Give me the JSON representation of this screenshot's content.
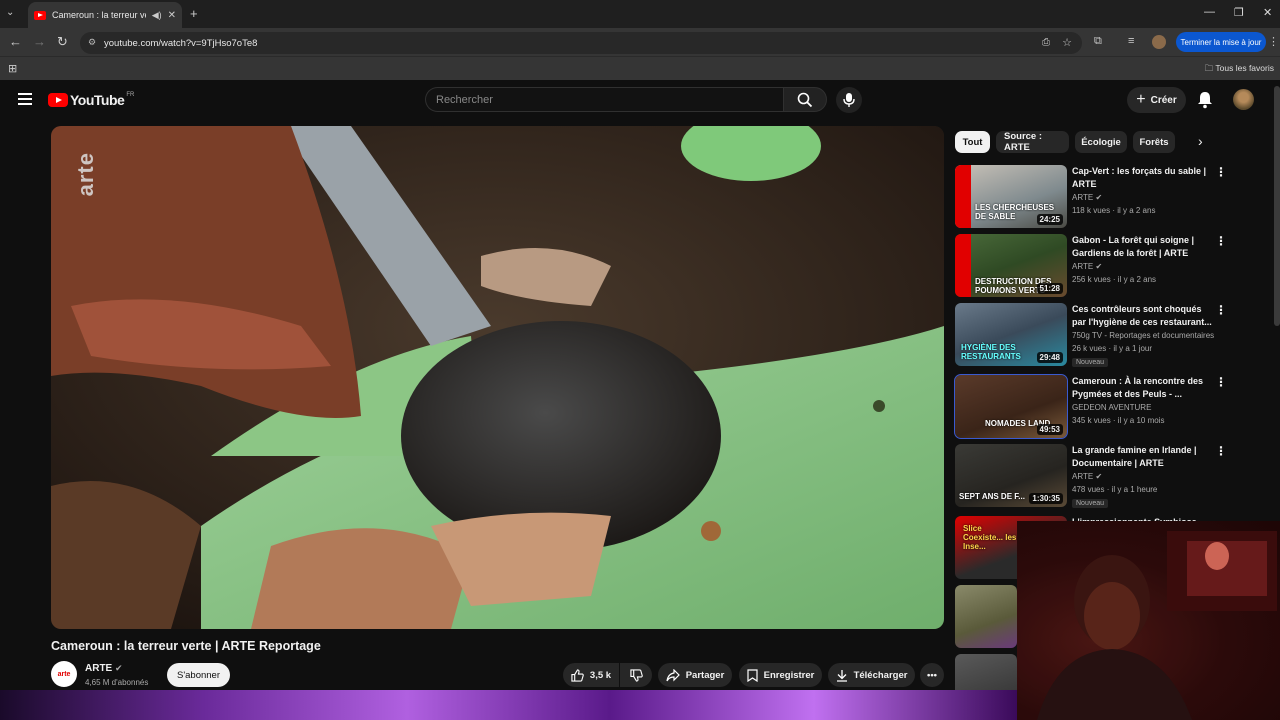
{
  "browser": {
    "tab_title": "Cameroun : la terreur verte",
    "url": "youtube.com/watch?v=9TjHso7oTe8",
    "update_button": "Terminer la mise à jour",
    "bookmarks_label": "Tous les favoris"
  },
  "youtube": {
    "logo_text": "YouTube",
    "region": "FR",
    "search_placeholder": "Rechercher",
    "create_label": "Créer"
  },
  "video": {
    "watermark": "arte",
    "title": "Cameroun : la terreur verte | ARTE Reportage",
    "channel": "ARTE",
    "channel_logo": "arte",
    "subscribers": "4,65 M d'abonnés",
    "subscribe_label": "S'abonner",
    "likes": "3,5 k",
    "share_label": "Partager",
    "save_label": "Enregistrer",
    "download_label": "Télécharger"
  },
  "chips": [
    "Tout",
    "Source : ARTE",
    "Écologie",
    "Forêts"
  ],
  "recommendations": [
    {
      "title": "Cap-Vert : les forçats du sable | ARTE",
      "channel": "ARTE",
      "meta": "118 k vues · il y a 2 ans",
      "duration": "24:25",
      "overlay": "LES CHERCHEUSES DE SABLE",
      "badge": ""
    },
    {
      "title": "Gabon - La forêt qui soigne | Gardiens de la forêt | ARTE",
      "channel": "ARTE",
      "meta": "256 k vues · il y a 2 ans",
      "duration": "51:28",
      "overlay": "DESTRUCTION DES POUMONS VERTS",
      "badge": ""
    },
    {
      "title": "Ces contrôleurs sont choqués par l'hygiène de ces restaurant...",
      "channel": "750g TV - Reportages et documentaires",
      "meta": "26 k vues · il y a 1 jour",
      "duration": "29:48",
      "overlay": "HYGIÈNE DES RESTAURANTS",
      "badge": "Nouveau"
    },
    {
      "title": "Cameroun : À la rencontre des Pygmées et des Peuls - ...",
      "channel": "GEDEON AVENTURE",
      "meta": "345 k vues · il y a 10 mois",
      "duration": "49:53",
      "overlay": "NOMADES LAND",
      "badge": ""
    },
    {
      "title": "La grande famine en Irlande | Documentaire | ARTE",
      "channel": "ARTE",
      "meta": "478 vues · il y a 1 heure",
      "duration": "1:30:35",
      "overlay": "SEPT ANS DE F...",
      "badge": "Nouveau"
    },
    {
      "title": "L'impressionnante Symbiose du...",
      "channel": "",
      "meta": "",
      "duration": "",
      "overlay": "Slice Coexiste... les Inse...",
      "badge": ""
    }
  ],
  "colors": {
    "yt_red": "#ff0000",
    "accent_blue": "#0b57d0",
    "background": "#0f0f0f"
  }
}
